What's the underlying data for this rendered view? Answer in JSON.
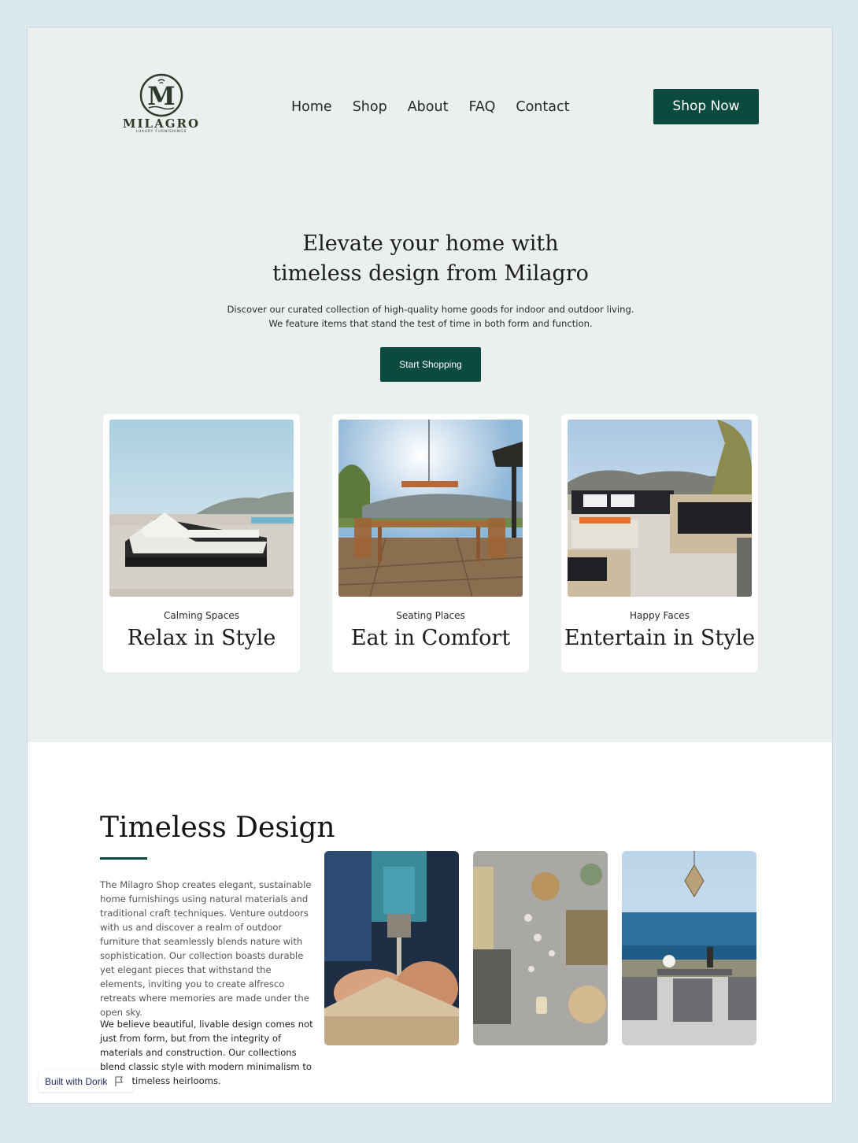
{
  "brand": {
    "name": "MILAGRO",
    "tagline": "LUXURY FURNISHINGS",
    "initial": "M",
    "color": "#2e3a2c"
  },
  "nav": {
    "items": [
      "Home",
      "Shop",
      "About",
      "FAQ",
      "Contact"
    ],
    "cta": "Shop Now"
  },
  "hero": {
    "title_line1": "Elevate your home with",
    "title_line2": "timeless design from Milagro",
    "sub_line1": "Discover our curated collection of high-quality home goods for indoor and outdoor living.",
    "sub_line2": "We feature items that stand the test of time in both form and function.",
    "button": "Start Shopping"
  },
  "cards": [
    {
      "eyebrow": "Calming Spaces",
      "title": "Relax in Style",
      "image": "poolside-loungers-photo"
    },
    {
      "eyebrow": "Seating Places",
      "title": "Eat in Comfort",
      "image": "outdoor-dining-photo"
    },
    {
      "eyebrow": "Happy Faces",
      "title": "Entertain in Style",
      "image": "patio-sofa-photo"
    }
  ],
  "timeless": {
    "title": "Timeless Design",
    "para1": "The Milagro Shop creates elegant, sustainable home furnishings using natural materials and traditional craft techniques. Venture outdoors with us and discover a realm of outdoor furniture that seamlessly blends nature with sophistication. Our collection boasts durable yet elegant pieces that withstand the elements, inviting you to create alfresco retreats where memories are made under the open sky.",
    "para2": "We believe beautiful, livable design comes not just from form, but from the integrity of materials and construction. Our collections blend classic style with modern minimalism to create timeless heirlooms.",
    "photos": [
      "woodworking-drill-photo",
      "material-samples-photo",
      "ocean-patio-photo"
    ]
  },
  "badge": {
    "text": "Built with Dorik"
  },
  "colors": {
    "accent": "#0b4a3f",
    "hero_bg": "#ebf0ef",
    "page_bg": "#dbe9ee"
  }
}
